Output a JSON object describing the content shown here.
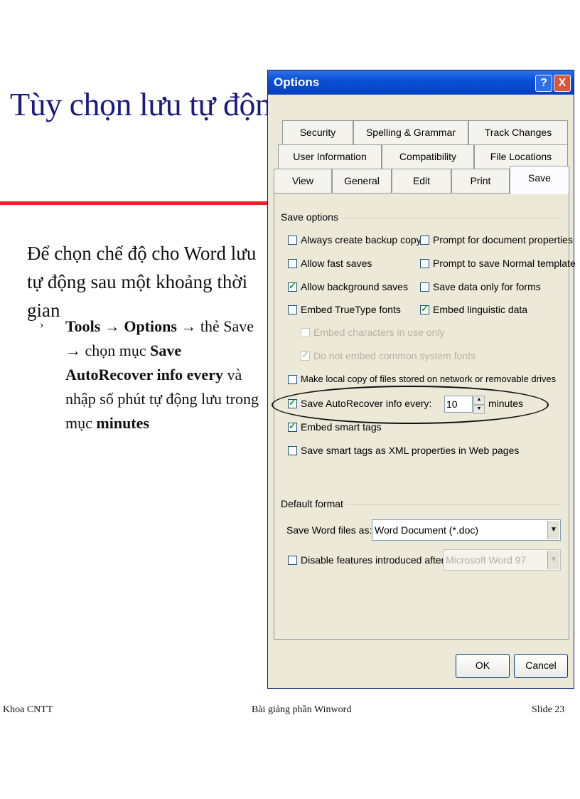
{
  "slide": {
    "title": "Tùy chọn lưu tự động",
    "intro": "Để chọn chế độ cho Word lưu tự động sau một khoảng thời gian",
    "bullet_marker": "›",
    "bullet": {
      "tools": "Tools",
      "arrow1": " → ",
      "options": "Options",
      "rest1": " → thẻ Save → chọn mục ",
      "sari": "Save AutoRecover info every",
      "rest2": " và nhập số phút tự động lưu trong mục ",
      "minutes": "minutes"
    },
    "footer_left": "Khoa CNTT",
    "footer_center": "Bài giảng phần Winword",
    "footer_right": "Slide 23",
    "accent_red": "#e8232a",
    "title_color": "#1a1a80"
  },
  "dialog": {
    "title": "Options",
    "help_label": "?",
    "close_label": "X",
    "tabs_row1": [
      "Security",
      "Spelling & Grammar",
      "Track Changes"
    ],
    "tabs_row2": [
      "User Information",
      "Compatibility",
      "File Locations"
    ],
    "tabs_row3": [
      "View",
      "General",
      "Edit",
      "Print",
      "Save"
    ],
    "active_tab": "Save",
    "save_options_label": "Save options",
    "checkboxes": {
      "backup": {
        "label": "Always create backup copy",
        "checked": false
      },
      "prompt_props": {
        "label": "Prompt for document properties",
        "checked": false
      },
      "fast_saves": {
        "label": "Allow fast saves",
        "checked": false
      },
      "prompt_normal": {
        "label": "Prompt to save Normal template",
        "checked": false
      },
      "background_saves": {
        "label": "Allow background saves",
        "checked": true
      },
      "data_forms": {
        "label": "Save data only for forms",
        "checked": false
      },
      "truetype": {
        "label": "Embed TrueType fonts",
        "checked": false
      },
      "linguistic": {
        "label": "Embed linguistic data",
        "checked": true
      },
      "chars_in_use": {
        "label": "Embed characters in use only",
        "checked": false,
        "disabled": true
      },
      "no_system_fonts": {
        "label": "Do not embed common system fonts",
        "checked": true,
        "disabled": true
      },
      "local_copy": {
        "label": "Make local copy of files stored on network or removable drives",
        "checked": false
      },
      "autorecover": {
        "label": "Save AutoRecover info every:",
        "checked": true
      },
      "smart_tags": {
        "label": "Embed smart tags",
        "checked": true
      },
      "xml_tags": {
        "label": "Save smart tags as XML properties in Web pages",
        "checked": false
      },
      "disable_features": {
        "label": "Disable features introduced after:",
        "checked": false
      }
    },
    "autorecover_value": "10",
    "autorecover_unit": "minutes",
    "default_format_label": "Default format",
    "save_word_as_label": "Save Word files as:",
    "save_word_as_value": "Word Document (*.doc)",
    "disable_after_value": "Microsoft Word 97",
    "ok_label": "OK",
    "cancel_label": "Cancel"
  }
}
